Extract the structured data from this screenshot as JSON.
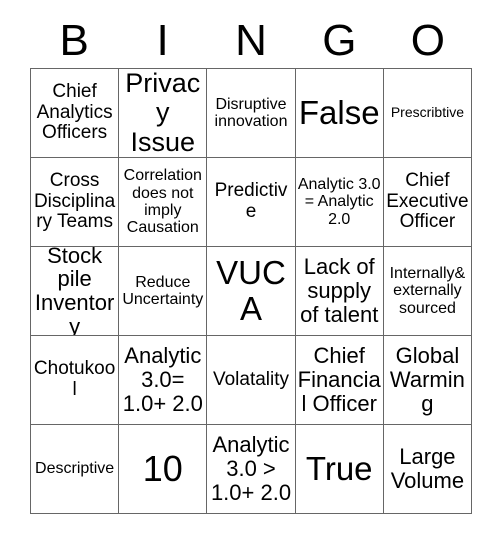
{
  "card": {
    "title_letters": [
      "B",
      "I",
      "N",
      "G",
      "O"
    ],
    "columns": 5,
    "rows": 5,
    "border_color": "#666666",
    "text_color": "#000000",
    "background_color": "#ffffff",
    "cells": [
      [
        {
          "text": "Chief Analytics Officers",
          "size": "fs-md"
        },
        {
          "text": "Privacy Issue",
          "size": "fs-xl"
        },
        {
          "text": "Disruptive innovation",
          "size": "fs-sm"
        },
        {
          "text": "False",
          "size": "fs-xxl"
        },
        {
          "text": "Prescribtive",
          "size": "fs-xs"
        }
      ],
      [
        {
          "text": "Cross Disciplinary Teams",
          "size": "fs-md"
        },
        {
          "text": "Correlation does not imply Causation",
          "size": "fs-sm"
        },
        {
          "text": "Predictive",
          "size": "fs-md"
        },
        {
          "text": "Analytic 3.0 = Analytic 2.0",
          "size": "fs-sm"
        },
        {
          "text": "Chief Executive Officer",
          "size": "fs-md"
        }
      ],
      [
        {
          "text": "Stock pile Inventory",
          "size": "fs-lg"
        },
        {
          "text": "Reduce Uncertainty",
          "size": "fs-sm"
        },
        {
          "text": "VUCA",
          "size": "fs-xxl"
        },
        {
          "text": "Lack of supply of talent",
          "size": "fs-lg"
        },
        {
          "text": "Internally& externally sourced",
          "size": "fs-sm"
        }
      ],
      [
        {
          "text": "Chotukool",
          "size": "fs-md"
        },
        {
          "text": "Analytic 3.0= 1.0+ 2.0",
          "size": "fs-lg"
        },
        {
          "text": "Volatality",
          "size": "fs-md"
        },
        {
          "text": "Chief Financial Officer",
          "size": "fs-lg"
        },
        {
          "text": "Global Warming",
          "size": "fs-lg"
        }
      ],
      [
        {
          "text": "Descriptive",
          "size": "fs-sm"
        },
        {
          "text": "10",
          "size": "fs-num"
        },
        {
          "text": "Analytic 3.0 > 1.0+ 2.0",
          "size": "fs-lg"
        },
        {
          "text": "True",
          "size": "fs-xxl"
        },
        {
          "text": "Large Volume",
          "size": "fs-lg"
        }
      ]
    ]
  }
}
